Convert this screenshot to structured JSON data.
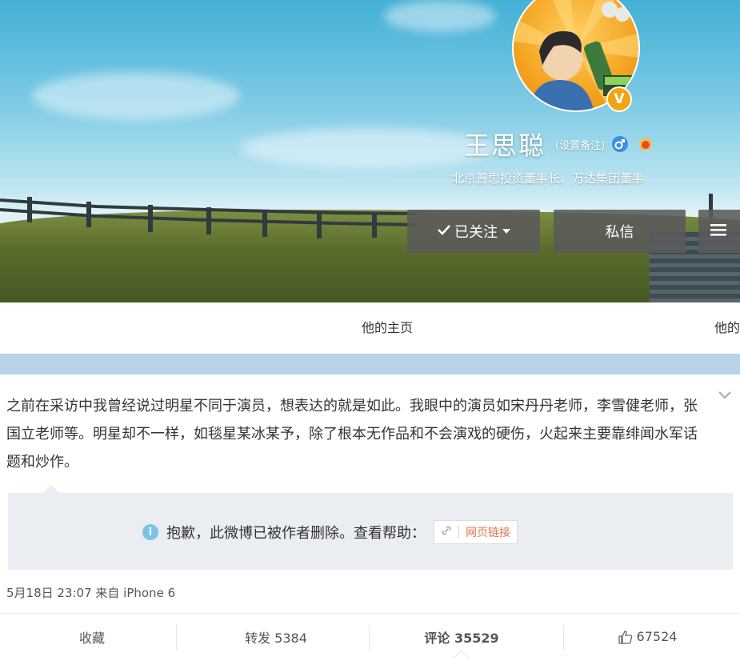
{
  "profile": {
    "name": "王思聪",
    "remark_link": "(设置备注)",
    "description": "北京普思投资董事长、万达集团董事",
    "verified_badge": "V"
  },
  "buttons": {
    "follow": "已关注",
    "message": "私信",
    "menu_icon": "menu-icon"
  },
  "tabs": {
    "home": "他的主页",
    "second": "他的"
  },
  "post": {
    "text": "之前在采访中我曾经说过明星不同于演员，想表达的就是如此。我眼中的演员如宋丹丹老师，李雪健老师，张国立老师等。明星却不一样，如毯星某冰某予，除了根本无作品和不会演戏的硬伤，火起来主要靠绯闻水军话题和炒作。",
    "deleted_notice": "抱歉，此微博已被作者删除。查看帮助：",
    "help_link": "网页链接",
    "meta": "5月18日 23:07 来自 iPhone 6"
  },
  "actions": {
    "favorite": "收藏",
    "forward": "转发 5384",
    "comment": "评论 35529",
    "like": "67524"
  },
  "colors": {
    "accent_orange": "#eb7350",
    "button_bg": "#5a5a5a",
    "band": "#b9d3e8",
    "quote_bg": "#eaedf1"
  }
}
